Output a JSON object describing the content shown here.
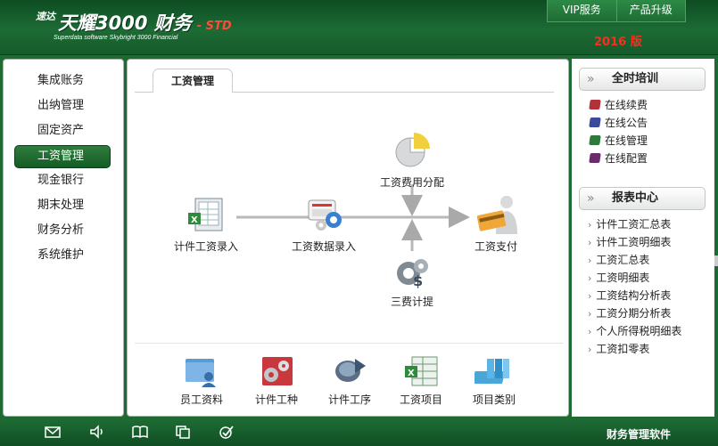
{
  "header": {
    "logo_small": "速达",
    "logo_big": "天耀3000 财务",
    "logo_edition": "- STD",
    "logo_sub": "Superdata software Skybright 3000 Financial",
    "nav": [
      "VIP服务",
      "产品升级"
    ],
    "version": "2016 版"
  },
  "sidebar": {
    "items": [
      "集成账务",
      "出纳管理",
      "固定资产",
      "工资管理",
      "现金银行",
      "期末处理",
      "财务分析",
      "系统维护"
    ],
    "active_index": 3
  },
  "main": {
    "tab": "工资管理",
    "flow": {
      "piece_wage_entry": "计件工资录入",
      "wage_data_entry": "工资数据录入",
      "wage_cost_allocation": "工资费用分配",
      "three_fee_accrual": "三费计提",
      "wage_payment": "工资支付"
    },
    "bottom": [
      "员工资料",
      "计件工种",
      "计件工序",
      "工资项目",
      "项目类别"
    ]
  },
  "right": {
    "training": {
      "title": "全时培训",
      "items": [
        "在线续费",
        "在线公告",
        "在线管理",
        "在线配置"
      ],
      "colors": [
        "#b2323a",
        "#3a4a9c",
        "#2e7a3c",
        "#6b2a6e"
      ]
    },
    "reports": {
      "title": "报表中心",
      "items": [
        "计件工资汇总表",
        "计件工资明细表",
        "工资汇总表",
        "工资明细表",
        "工资结构分析表",
        "工资分期分析表",
        "个人所得税明细表",
        "工资扣零表"
      ]
    }
  },
  "footer": {
    "label": "财务管理软件",
    "icons": [
      "mail-icon",
      "speaker-icon",
      "book-icon",
      "copy-icon",
      "check-icon"
    ]
  }
}
